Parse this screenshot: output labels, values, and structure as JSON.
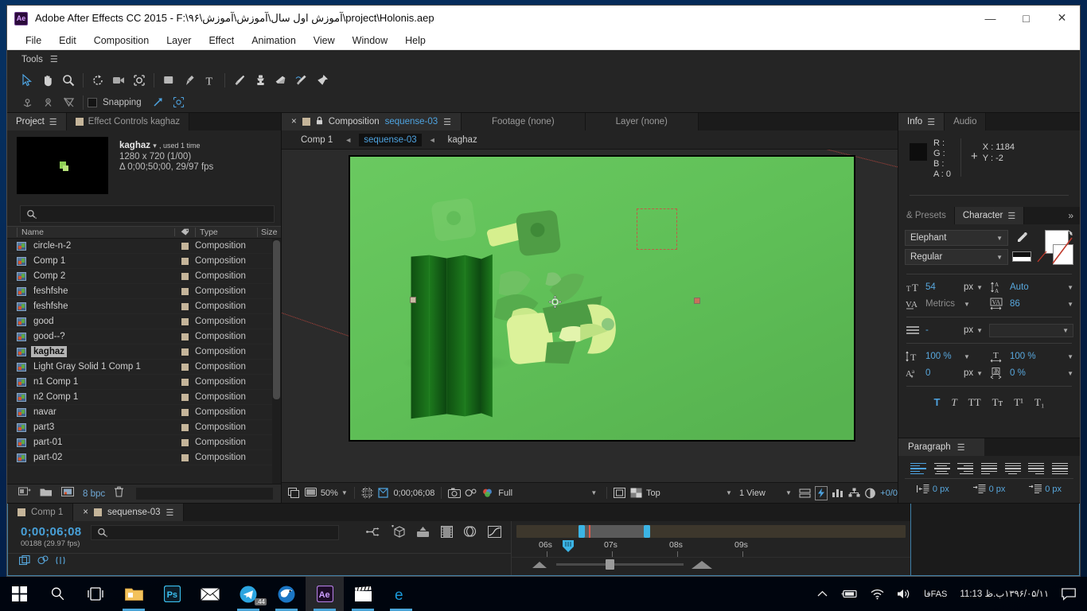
{
  "window": {
    "app_icon": "Ae",
    "title": "Adobe After Effects CC 2015 - F:\\۹۶\\آموزش اول سال\\آموزش\\آموزش\\project\\Holonis.aep",
    "minimize": "—",
    "maximize": "□",
    "close": "✕"
  },
  "menu": {
    "items": [
      "File",
      "Edit",
      "Composition",
      "Layer",
      "Effect",
      "Animation",
      "View",
      "Window",
      "Help"
    ]
  },
  "tools": {
    "panel_label": "Tools",
    "menu_glyph": "☰",
    "snapping_label": "Snapping",
    "row1": [
      {
        "name": "selection-tool",
        "glyph": "⌖"
      },
      {
        "name": "hand-tool",
        "glyph": "✋"
      },
      {
        "name": "zoom-tool",
        "glyph": "🔍"
      },
      {
        "name": "rotation-tool",
        "glyph": "⟳"
      },
      {
        "name": "camera-tool",
        "glyph": "▣"
      },
      {
        "name": "pan-behind-tool",
        "glyph": "✥"
      },
      {
        "name": "shape-tool",
        "glyph": "▢"
      },
      {
        "name": "pen-tool",
        "glyph": "✒"
      },
      {
        "name": "type-tool",
        "glyph": "T"
      },
      {
        "name": "brush-tool",
        "glyph": "/"
      },
      {
        "name": "clone-stamp-tool",
        "glyph": "⌷"
      },
      {
        "name": "eraser-tool",
        "glyph": "▱"
      },
      {
        "name": "roto-brush-tool",
        "glyph": "✦"
      },
      {
        "name": "puppet-pin-tool",
        "glyph": "✛"
      }
    ],
    "row2": [
      {
        "name": "unified-camera-icon",
        "glyph": "⎈"
      },
      {
        "name": "orbit-camera-icon",
        "glyph": "⊙"
      },
      {
        "name": "track-camera-icon",
        "glyph": "▽"
      }
    ]
  },
  "project": {
    "tabs": [
      {
        "label": "Project",
        "active": true,
        "has_swatch": false
      },
      {
        "label": "Effect Controls kaghaz",
        "active": false,
        "has_swatch": true
      }
    ],
    "menu_glyph": "☰",
    "selected_item": {
      "name": "kaghaz",
      "usage": ", used 1 time",
      "dimensions": "1280 x 720 (1/00)",
      "duration": "Δ 0;00;50;00, 29/97 fps"
    },
    "search_placeholder": "",
    "columns": [
      "Name",
      "Type",
      "Size"
    ],
    "items": [
      {
        "name": "circle-n-2",
        "type": "Composition",
        "size": ""
      },
      {
        "name": "Comp 1",
        "type": "Composition",
        "size": ""
      },
      {
        "name": "Comp 2",
        "type": "Composition",
        "size": ""
      },
      {
        "name": "feshfshe",
        "type": "Composition",
        "size": ""
      },
      {
        "name": "feshfshe",
        "type": "Composition",
        "size": ""
      },
      {
        "name": "good",
        "type": "Composition",
        "size": ""
      },
      {
        "name": "good--?",
        "type": "Composition",
        "size": ""
      },
      {
        "name": "kaghaz",
        "type": "Composition",
        "size": "",
        "selected": true
      },
      {
        "name": "Light Gray Solid 1 Comp 1",
        "type": "Composition",
        "size": ""
      },
      {
        "name": "n1 Comp 1",
        "type": "Composition",
        "size": ""
      },
      {
        "name": "n2 Comp 1",
        "type": "Composition",
        "size": ""
      },
      {
        "name": "navar",
        "type": "Composition",
        "size": ""
      },
      {
        "name": "part3",
        "type": "Composition",
        "size": ""
      },
      {
        "name": "part-01",
        "type": "Composition",
        "size": ""
      },
      {
        "name": "part-02",
        "type": "Composition",
        "size": ""
      }
    ],
    "footer": {
      "bit_depth": "8 bpc"
    }
  },
  "composition": {
    "tabs": [
      {
        "label_prefix": "Composition",
        "label_name": "sequense-03",
        "active": true
      },
      {
        "label": "Footage (none)",
        "active": false
      },
      {
        "label": "Layer (none)",
        "active": false
      }
    ],
    "menu_glyph": "☰",
    "close_glyph": "×",
    "lock_glyph": "🔒",
    "breadcrumb": [
      {
        "label": "Comp 1",
        "active": false
      },
      {
        "label": "sequense-03",
        "active": true
      },
      {
        "label": "kaghaz",
        "active": false
      }
    ],
    "breadcrumb_arrow": "◄",
    "toolbar": {
      "magnification": "50%",
      "current_time": "0;00;06;08",
      "resolution": "Full",
      "view_layout": "Top",
      "views": "1 View",
      "region_offset": "+0/0"
    }
  },
  "info": {
    "tabs": [
      {
        "label": "Info",
        "active": true
      },
      {
        "label": "Audio",
        "active": false
      }
    ],
    "menu_glyph": "☰",
    "channels": [
      "R :",
      "G :",
      "B :",
      "A : 0"
    ],
    "x": "X : 1184",
    "y": "Y : -2",
    "crosshair": "+"
  },
  "character": {
    "tabs": [
      {
        "label": "& Presets",
        "active": false
      },
      {
        "label": "Character",
        "active": true
      }
    ],
    "menu_glyph": "☰",
    "more_glyph": "»",
    "font_family": "Elephant",
    "font_style": "Regular",
    "font_size": "54",
    "font_size_unit": "px",
    "leading": "Auto",
    "kerning": "Metrics",
    "tracking": "86",
    "stroke_width": "-",
    "stroke_width_unit": "px",
    "vertical_scale": "100 %",
    "horizontal_scale": "100 %",
    "baseline_shift": "0",
    "baseline_shift_unit": "px",
    "tsume": "0 %",
    "style_buttons": [
      "T",
      "T",
      "TT",
      "Tᴛ",
      "T¹",
      "T₁"
    ]
  },
  "paragraph": {
    "title": "Paragraph",
    "menu_glyph": "☰",
    "indent_left": "0 px",
    "indent_right": "0 px",
    "indent_first": "0 px"
  },
  "timeline": {
    "tabs": [
      {
        "label": "Comp 1",
        "active": false,
        "closable": false
      },
      {
        "label": "sequense-03",
        "active": true,
        "closable": true
      }
    ],
    "menu_glyph": "☰",
    "close_glyph": "×",
    "current_time": "0;00;06;08",
    "frame_info": "00188 (29.97 fps)",
    "search_placeholder": "",
    "ruler_ticks": [
      "06s",
      "07s",
      "08s",
      "09s"
    ]
  },
  "taskbar": {
    "items": [
      {
        "name": "start-button",
        "glyph": "⊞",
        "active": false,
        "running": false
      },
      {
        "name": "search-icon",
        "glyph": "🔍",
        "active": false,
        "running": false
      },
      {
        "name": "task-view-icon",
        "glyph": "▯",
        "active": false,
        "running": false
      },
      {
        "name": "file-explorer-icon",
        "glyph": "📁",
        "active": false,
        "running": true
      },
      {
        "name": "photoshop-icon",
        "glyph": "Ps",
        "active": false,
        "running": false
      },
      {
        "name": "mail-icon",
        "glyph": "✉",
        "active": false,
        "running": false
      },
      {
        "name": "telegram-icon",
        "glyph": "✈",
        "active": false,
        "running": true,
        "badge": ".44"
      },
      {
        "name": "thunderbird-icon",
        "glyph": "🦅",
        "active": false,
        "running": true
      },
      {
        "name": "after-effects-icon",
        "glyph": "Ae",
        "active": true,
        "running": true
      },
      {
        "name": "premiere-icon",
        "glyph": "🎬",
        "active": false,
        "running": true
      },
      {
        "name": "edge-icon",
        "glyph": "e",
        "active": false,
        "running": true
      }
    ],
    "tray": {
      "chevron": "⌃",
      "battery": "🔋",
      "wifi": "📶",
      "volume": "🔊",
      "lang_top": "فا",
      "lang_bottom": "FAS",
      "time": "11:13 ب.ظ",
      "date": "۱۳۹۶/۰۵/۱۱",
      "action_center": "🗨"
    }
  },
  "canvas": {
    "background_color": "#5fbf57",
    "selection_color": "#c25a46",
    "guide_color": "#b5443c"
  }
}
